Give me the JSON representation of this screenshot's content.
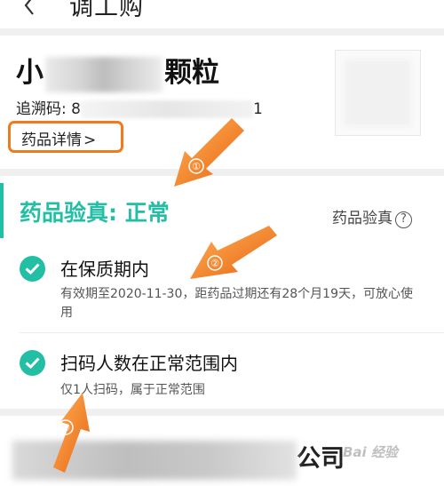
{
  "header": {
    "title": "调工购"
  },
  "product": {
    "name_start": "小",
    "name_end": "颗粒",
    "trace_label": "追溯码: 8",
    "trace_end": "1",
    "detail_link": "药品详情",
    "detail_chevron": ">"
  },
  "verify": {
    "title": "药品验真: 正常",
    "link_label": "药品验真",
    "help_glyph": "?",
    "items": [
      {
        "title": "在保质期内",
        "desc": "有效期至2020-11-30，距药品过期还有28个月19天，可放心使用"
      },
      {
        "title": "扫码人数在正常范围内",
        "desc": "仅1人扫码，属于正常范围"
      }
    ]
  },
  "company": {
    "name_end": "公司"
  },
  "annotations": {
    "mark1": "①",
    "mark2": "②",
    "mark3": "③"
  },
  "watermark": "Bai 经验",
  "colors": {
    "accent": "#23bfa4",
    "annotation": "#f07a1c"
  }
}
